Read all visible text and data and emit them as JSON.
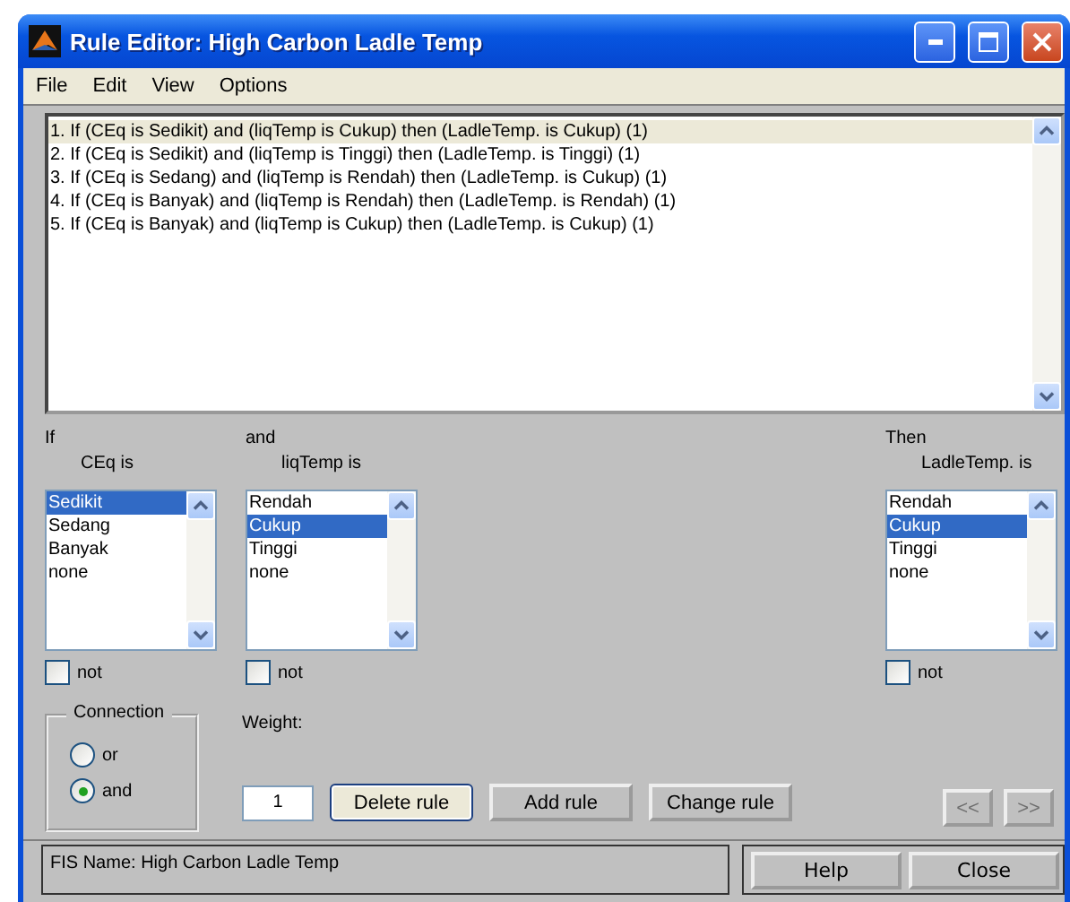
{
  "window": {
    "title": "Rule Editor: High Carbon Ladle Temp"
  },
  "menu": [
    "File",
    "Edit",
    "View",
    "Options"
  ],
  "rules": [
    {
      "text": "1. If (CEq is Sedikit) and (liqTemp is Cukup) then (LadleTemp. is Cukup) (1)",
      "selected": true
    },
    {
      "text": "2. If (CEq is Sedikit) and (liqTemp is Tinggi) then (LadleTemp. is Tinggi) (1)",
      "selected": false
    },
    {
      "text": "3. If (CEq is Sedang) and (liqTemp is Rendah) then (LadleTemp. is Cukup) (1)",
      "selected": false
    },
    {
      "text": "4. If (CEq is Banyak) and (liqTemp is Rendah) then (LadleTemp. is Rendah) (1)",
      "selected": false
    },
    {
      "text": "5. If (CEq is Banyak) and (liqTemp is Cukup) then (LadleTemp. is Cukup) (1)",
      "selected": false
    }
  ],
  "variables": [
    {
      "kind": "input",
      "connective": "If",
      "label": "CEq is",
      "items": [
        {
          "label": "Sedikit",
          "selected": true
        },
        {
          "label": "Sedang",
          "selected": false
        },
        {
          "label": "Banyak",
          "selected": false
        },
        {
          "label": "none",
          "selected": false
        }
      ],
      "not": {
        "label": "not",
        "checked": false
      }
    },
    {
      "kind": "input",
      "connective": "and",
      "label": "liqTemp is",
      "items": [
        {
          "label": "Rendah",
          "selected": false
        },
        {
          "label": "Cukup",
          "selected": true
        },
        {
          "label": "Tinggi",
          "selected": false
        },
        {
          "label": "none",
          "selected": false
        }
      ],
      "not": {
        "label": "not",
        "checked": false
      }
    },
    {
      "kind": "output",
      "connective": "Then",
      "label": "LadleTemp. is",
      "items": [
        {
          "label": "Rendah",
          "selected": false
        },
        {
          "label": "Cukup",
          "selected": true
        },
        {
          "label": "Tinggi",
          "selected": false
        },
        {
          "label": "none",
          "selected": false
        }
      ],
      "not": {
        "label": "not",
        "checked": false
      }
    }
  ],
  "connection": {
    "title": "Connection",
    "options": [
      {
        "label": "or",
        "selected": false
      },
      {
        "label": "and",
        "selected": true
      }
    ]
  },
  "weight": {
    "label": "Weight:",
    "value": "1"
  },
  "rule_buttons": [
    {
      "label": "Delete rule",
      "focused": true
    },
    {
      "label": "Add rule",
      "focused": false
    },
    {
      "label": "Change rule",
      "focused": false
    }
  ],
  "nav_buttons": [
    {
      "label": "<<",
      "disabled": true
    },
    {
      "label": ">>",
      "disabled": true
    }
  ],
  "status": {
    "text": "FIS Name: High Carbon Ladle Temp"
  },
  "footer_buttons": [
    "Help",
    "Close"
  ]
}
